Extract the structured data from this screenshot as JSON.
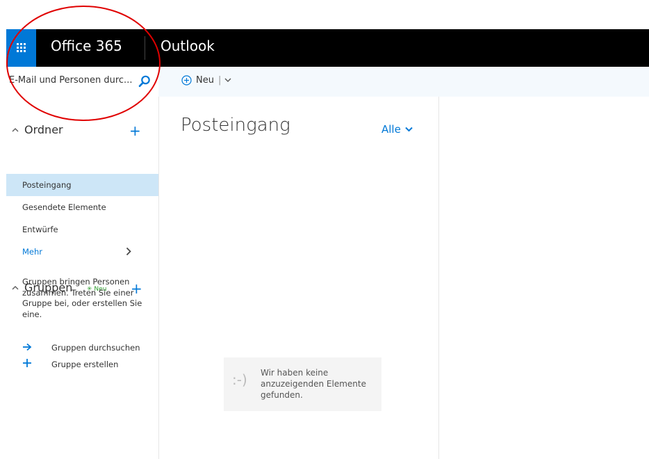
{
  "topbar": {
    "waffle_icon": "app-launcher-icon",
    "brand": "Office 365",
    "app": "Outlook"
  },
  "search": {
    "placeholder": "E-Mail und Personen durc...",
    "icon": "search-icon"
  },
  "toolbar": {
    "new_label": "Neu",
    "new_separator": "|"
  },
  "folders": {
    "header": "Ordner",
    "items": [
      {
        "label": "Posteingang",
        "selected": true
      },
      {
        "label": "Gesendete Elemente",
        "selected": false
      },
      {
        "label": "Entwürfe",
        "selected": false
      }
    ],
    "more": "Mehr"
  },
  "groups": {
    "header": "Gruppen",
    "badge": "Neu",
    "description": "Gruppen bringen Personen zusammen. Treten Sie einer Gruppe bei, oder erstellen Sie eine.",
    "browse": "Gruppen durchsuchen",
    "create": "Gruppe erstellen"
  },
  "messagelist": {
    "title": "Posteingang",
    "filter": "Alle",
    "empty_face": ":-)",
    "empty_text": "Wir haben keine anzuzeigenden Elemente gefunden."
  },
  "colors": {
    "accent": "#0078d7",
    "topbar": "#000000",
    "selected": "#cde6f7",
    "annotation": "#e00000",
    "badge": "#2e9d2e"
  }
}
